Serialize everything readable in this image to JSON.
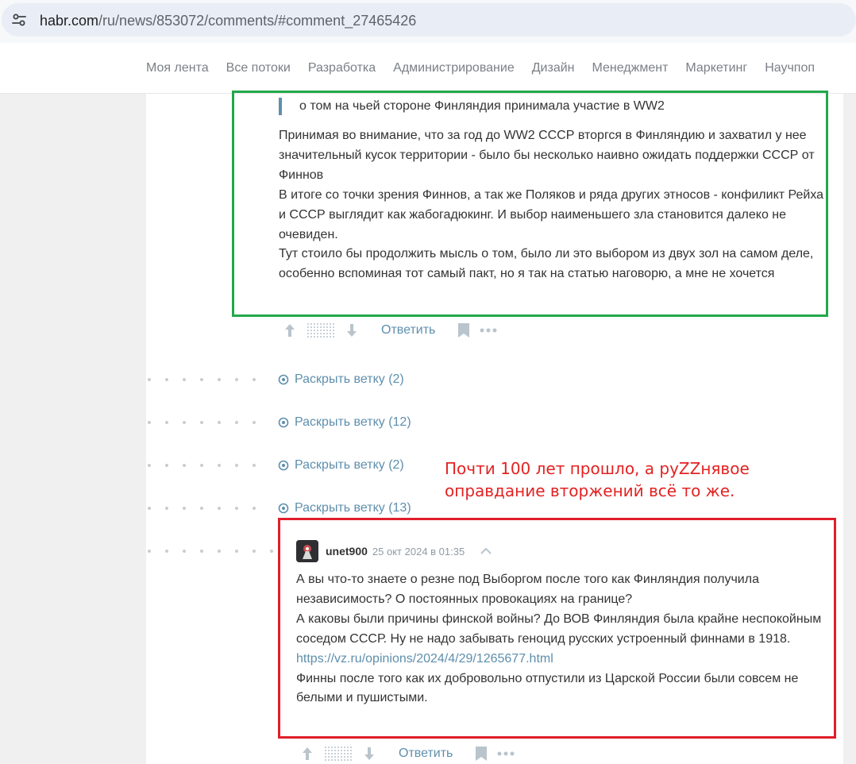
{
  "browser": {
    "url_host": "habr.com",
    "url_path": "/ru/news/853072/comments/#comment_27465426",
    "site_info_icon": "tune-icon"
  },
  "nav": {
    "items": [
      "Моя лента",
      "Все потоки",
      "Разработка",
      "Администрирование",
      "Дизайн",
      "Менеджмент",
      "Маркетинг",
      "Научпоп"
    ]
  },
  "comment1": {
    "quote": "о том на чьей стороне Финляндия принимала участие в WW2",
    "lines": [
      "Принимая во внимание, что за год до WW2 СССР вторгся в Финляндию и захватил у нее значительный кусок территории - было бы несколько наивно ожидать поддержки СССР от Финнов",
      "В итоге со точки зрения Финнов, а так же Поляков и ряда других этносов - конфиликт Рейха и СССР выглядит как жабогадюкинг. И выбор наименьшего зла становится далеко не очевиден.",
      "Тут стоило бы продолжить мысль о том, было ли это выбором из двух зол на самом деле, особенно вспоминая тот самый пакт, но я так на статью наговорю, а мне не хочется"
    ],
    "reply_label": "Ответить"
  },
  "branches": [
    {
      "label": "Раскрыть ветку (2)"
    },
    {
      "label": "Раскрыть ветку (12)"
    },
    {
      "label": "Раскрыть ветку (2)"
    },
    {
      "label": "Раскрыть ветку (13)"
    }
  ],
  "annotation": {
    "line1": "Почти 100 лет прошло, а руZZнявое",
    "line2": "оправдание вторжений всё то же."
  },
  "comment2": {
    "username": "unet900",
    "timestamp": "25 окт 2024 в 01:35",
    "line1": "А вы что-то знаете о резне под Выборгом после того как Финляндия получила независимость? О постоянных провокациях на границе?",
    "line2": "А каковы были причины финской войны? До ВОВ Финляндия была крайне неспокойным соседом СССР. Ну не надо забывать геноцид русских устроенный финнами в 1918.",
    "link": "https://vz.ru/opinions/2024/4/29/1265677.html",
    "line3": "Финны после того как их добровольно отпустили из Царской России были совсем не белыми и пушистыми.",
    "reply_label": "Ответить"
  },
  "colors": {
    "link": "#5e8fad",
    "highlight_green": "#22a84a",
    "highlight_red": "#e01e2a",
    "annotation_text": "#e32222"
  }
}
